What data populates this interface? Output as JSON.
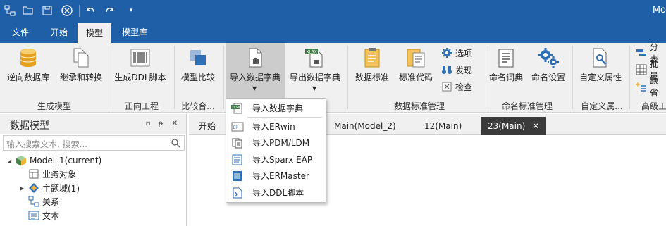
{
  "app": {
    "title": "Mo"
  },
  "quick_access": [
    "connect-icon",
    "open-folder-icon",
    "save-icon",
    "close-circle-icon",
    "undo-icon",
    "redo-icon",
    "dropdown-icon"
  ],
  "tabs": [
    {
      "label": "文件"
    },
    {
      "label": "开始"
    },
    {
      "label": "模型"
    },
    {
      "label": "模型库"
    }
  ],
  "ribbon": {
    "buttons": {
      "reverse_db": "逆向数据库",
      "inherit_convert": "继承和转换",
      "gen_ddl": "生成DDL脚本",
      "model_compare": "模型比较",
      "import_dict": "导入数据字典",
      "export_dict": "导出数据字典",
      "data_standard": "数据标准",
      "standard_code": "标准代码",
      "naming_dict": "命名词典",
      "naming_settings": "命名设置",
      "custom_attr": "自定义属性"
    },
    "small": {
      "options": "选项",
      "discover": "发现",
      "check": "检查",
      "classify": "分表",
      "batch": "批量",
      "missing": "缺省"
    },
    "groups": {
      "gen_model": "生成模型",
      "forward_eng": "正向工程",
      "compare": "比较合...",
      "data_std_mgmt": "数据标准管理",
      "naming_std_mgmt": "命名标准管理",
      "custom_attr": "自定义属...",
      "advanced": "高级工"
    }
  },
  "import_menu": {
    "items": [
      {
        "label": "导入数据字典"
      },
      {
        "label": "导入ERwin"
      },
      {
        "label": "导入PDM/LDM"
      },
      {
        "label": "导入Sparx EAP"
      },
      {
        "label": "导入ERMaster"
      },
      {
        "label": "导入DDL脚本"
      }
    ]
  },
  "panel": {
    "title": "数据模型",
    "search_placeholder": "输入搜索文本, 搜索...",
    "tree": [
      {
        "label": "Model_1(current)"
      },
      {
        "label": "业务对象"
      },
      {
        "label": "主题域(1)"
      },
      {
        "label": "关系"
      },
      {
        "label": "文本"
      }
    ]
  },
  "doc_tabs": [
    {
      "label": "开始"
    },
    {
      "label": "Main(Model_2)"
    },
    {
      "label": "12(Main)"
    },
    {
      "label": "23(Main)"
    }
  ],
  "colors": {
    "title_bar": "#1f5fa8",
    "ribbon_bg": "#f0f0f0",
    "active_tab_dark": "#3a3a3a"
  }
}
